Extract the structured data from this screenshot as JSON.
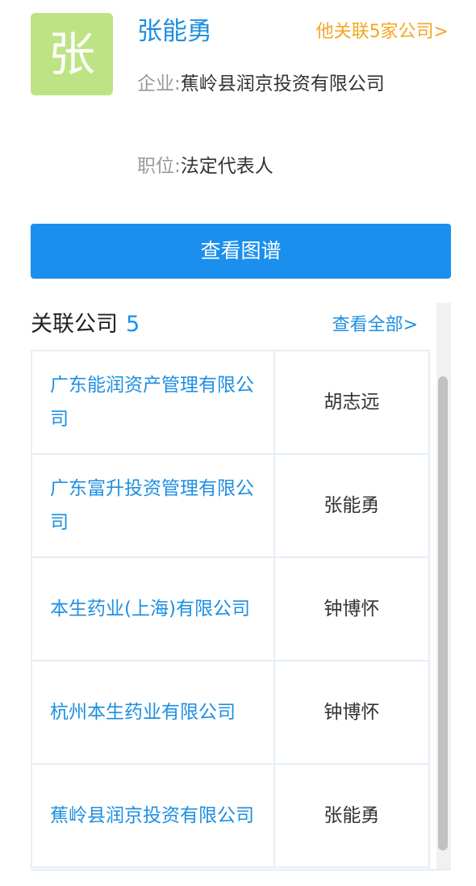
{
  "profile": {
    "avatar_char": "张",
    "name": "张能勇",
    "related_link": "他关联5家公司>",
    "company_label": "企业:",
    "company_value": "蕉岭县润京投资有限公司",
    "position_label": "职位:",
    "position_value": "法定代表人"
  },
  "actions": {
    "graph_button": "查看图谱"
  },
  "related_companies": {
    "title": "关联公司",
    "count": "5",
    "view_all": "查看全部>",
    "rows": [
      {
        "company": "广东能润资产管理有限公司",
        "representative": "胡志远"
      },
      {
        "company": "广东富升投资管理有限公司",
        "representative": "张能勇"
      },
      {
        "company": "本生药业(上海)有限公司",
        "representative": "钟博怀"
      },
      {
        "company": "杭州本生药业有限公司",
        "representative": "钟博怀"
      },
      {
        "company": "蕉岭县润京投资有限公司",
        "representative": "张能勇"
      }
    ]
  },
  "colors": {
    "accent": "#1a8fee",
    "link_blue": "#1e8fe1",
    "orange": "#f5a623",
    "avatar_bg": "#bde384"
  }
}
